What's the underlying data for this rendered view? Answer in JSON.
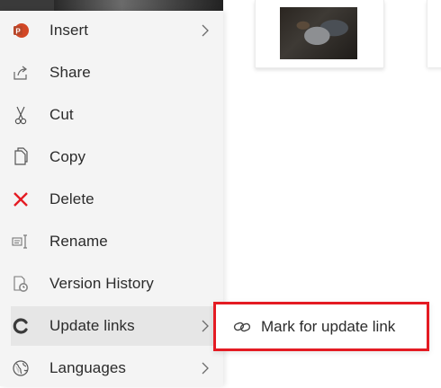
{
  "menu": {
    "items": [
      {
        "label": "Insert",
        "icon": "powerpoint-icon",
        "has_submenu": true
      },
      {
        "label": "Share",
        "icon": "share-icon",
        "has_submenu": false
      },
      {
        "label": "Cut",
        "icon": "scissors-icon",
        "has_submenu": false
      },
      {
        "label": "Copy",
        "icon": "copy-icon",
        "has_submenu": false
      },
      {
        "label": "Delete",
        "icon": "delete-x-icon",
        "has_submenu": false
      },
      {
        "label": "Rename",
        "icon": "rename-icon",
        "has_submenu": false
      },
      {
        "label": "Version History",
        "icon": "version-history-icon",
        "has_submenu": false
      },
      {
        "label": "Update links",
        "icon": "update-links-icon",
        "has_submenu": true,
        "active": true
      },
      {
        "label": "Languages",
        "icon": "globe-icon",
        "has_submenu": true
      }
    ]
  },
  "submenu": {
    "items": [
      {
        "label": "Mark for update link",
        "icon": "link-icon"
      }
    ]
  },
  "colors": {
    "highlight_border": "#e41b23",
    "delete_red": "#e41b23",
    "powerpoint_orange": "#d24726",
    "menu_bg": "#f4f4f4",
    "active_bg": "#e6e6e6"
  }
}
